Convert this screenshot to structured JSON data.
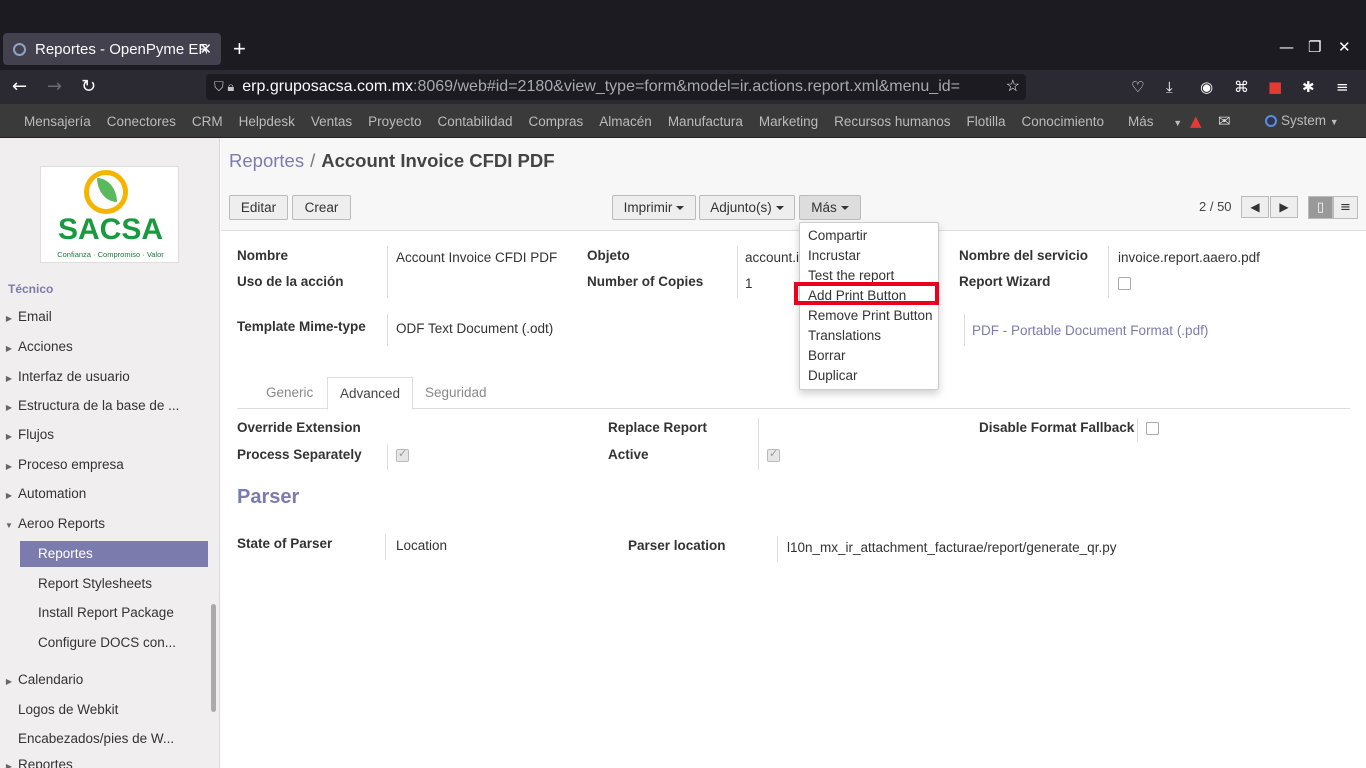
{
  "browser": {
    "tab_title": "Reportes - OpenPyme ERP",
    "url_host": "erp.gruposacsa.com.mx",
    "url_path": ":8069/web#id=2180&view_type=form&model=ir.actions.report.xml&menu_id="
  },
  "topmenu": {
    "items": [
      "Mensajería",
      "Conectores",
      "CRM",
      "Helpdesk",
      "Ventas",
      "Proyecto",
      "Contabilidad",
      "Compras",
      "Almacén",
      "Manufactura",
      "Marketing",
      "Recursos humanos",
      "Flotilla",
      "Conocimiento",
      "Más"
    ],
    "user": "System"
  },
  "logo": {
    "word": "SACSA",
    "tagline": "Confianza · Compromiso · Valor"
  },
  "sidebar": {
    "partial": "Técnico",
    "items": [
      {
        "label": "Email"
      },
      {
        "label": "Acciones"
      },
      {
        "label": "Interfaz de usuario"
      },
      {
        "label": "Estructura de la base de ..."
      },
      {
        "label": "Flujos"
      },
      {
        "label": "Proceso empresa"
      },
      {
        "label": "Automation"
      },
      {
        "label": "Aeroo Reports"
      },
      {
        "label": "Reportes"
      },
      {
        "label": "Report Stylesheets"
      },
      {
        "label": "Install Report Package"
      },
      {
        "label": "Configure DOCS con..."
      },
      {
        "label": "Calendario"
      },
      {
        "label": "Logos de Webkit"
      },
      {
        "label": "Encabezados/pies de W..."
      },
      {
        "label": "Reportes"
      }
    ]
  },
  "breadcrumb": {
    "parent": "Reportes",
    "separator": "/",
    "current": "Account Invoice CFDI PDF"
  },
  "toolbar": {
    "edit": "Editar",
    "create": "Crear",
    "print": "Imprimir",
    "attachments": "Adjunto(s)",
    "more": "Más",
    "pager": "2 / 50"
  },
  "form": {
    "name_label": "Nombre",
    "name_value": "Account Invoice CFDI PDF",
    "object_label": "Objeto",
    "object_value": "account.in",
    "service_label": "Nombre del servicio",
    "service_value": "invoice.report.aaero.pdf",
    "usage_label": "Uso de la acción",
    "copies_label": "Number of Copies",
    "copies_value": "1",
    "wizard_label": "Report Wizard",
    "mime_label": "Template Mime-type",
    "mime_value": "ODF Text Document (.odt)",
    "output_value": "PDF - Portable Document Format (.pdf)"
  },
  "tabs": [
    "Generic",
    "Advanced",
    "Seguridad"
  ],
  "advanced": {
    "override_label": "Override Extension",
    "replace_label": "Replace Report",
    "fallback_label": "Disable Format Fallback",
    "separately_label": "Process Separately",
    "active_label": "Active"
  },
  "parser": {
    "title": "Parser",
    "state_label": "State of Parser",
    "state_value": "Location",
    "location_label": "Parser location",
    "location_value": "l10n_mx_ir_attachment_facturae/report/generate_qr.py"
  },
  "dropdown": {
    "items": [
      "Compartir",
      "Incrustar",
      "Test the report",
      "Add Print Button",
      "Remove Print Button",
      "Translations",
      "Borrar",
      "Duplicar"
    ]
  }
}
